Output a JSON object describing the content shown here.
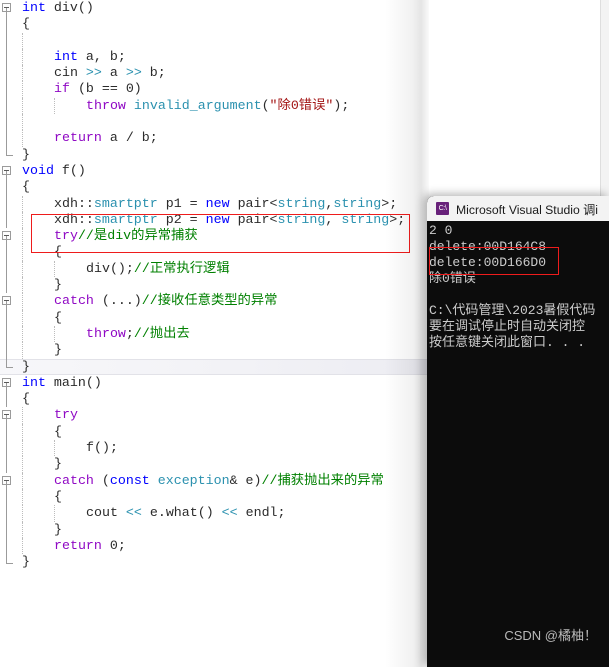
{
  "editor": {
    "language": "cpp",
    "lines": [
      {
        "fold": "open",
        "indent": 0,
        "tokens": [
          {
            "t": "int",
            "c": "kw"
          },
          {
            "t": " div()",
            "c": "plain"
          }
        ]
      },
      {
        "fold": "bar",
        "indent": 0,
        "tokens": [
          {
            "t": "{",
            "c": "plain"
          }
        ]
      },
      {
        "fold": "bar",
        "indent": 1,
        "tokens": []
      },
      {
        "fold": "bar",
        "indent": 1,
        "tokens": [
          {
            "t": "int",
            "c": "kw"
          },
          {
            "t": " a, b;",
            "c": "plain"
          }
        ]
      },
      {
        "fold": "bar",
        "indent": 1,
        "tokens": [
          {
            "t": "cin ",
            "c": "plain"
          },
          {
            "t": ">>",
            "c": "type"
          },
          {
            "t": " a ",
            "c": "plain"
          },
          {
            "t": ">>",
            "c": "type"
          },
          {
            "t": " b;",
            "c": "plain"
          }
        ]
      },
      {
        "fold": "bar",
        "indent": 1,
        "tokens": [
          {
            "t": "if",
            "c": "kw2"
          },
          {
            "t": " (b == 0)",
            "c": "plain"
          }
        ]
      },
      {
        "fold": "bar",
        "indent": 2,
        "tokens": [
          {
            "t": "throw",
            "c": "kw2"
          },
          {
            "t": " ",
            "c": "plain"
          },
          {
            "t": "invalid_argument",
            "c": "type"
          },
          {
            "t": "(",
            "c": "plain"
          },
          {
            "t": "\"除0错误\"",
            "c": "str"
          },
          {
            "t": ");",
            "c": "plain"
          }
        ]
      },
      {
        "fold": "bar",
        "indent": 1,
        "tokens": []
      },
      {
        "fold": "bar",
        "indent": 1,
        "tokens": [
          {
            "t": "return",
            "c": "kw2"
          },
          {
            "t": " a / b;",
            "c": "plain"
          }
        ]
      },
      {
        "fold": "end",
        "indent": 0,
        "tokens": [
          {
            "t": "}",
            "c": "plain"
          }
        ]
      },
      {
        "fold": "open",
        "indent": 0,
        "tokens": [
          {
            "t": "void",
            "c": "kw"
          },
          {
            "t": " f()",
            "c": "plain"
          }
        ]
      },
      {
        "fold": "bar",
        "indent": 0,
        "tokens": [
          {
            "t": "{",
            "c": "plain"
          }
        ]
      },
      {
        "fold": "bar",
        "indent": 1,
        "tokens": [
          {
            "t": "xdh::",
            "c": "plain"
          },
          {
            "t": "smartptr",
            "c": "type"
          },
          {
            "t": " p1 = ",
            "c": "plain"
          },
          {
            "t": "new",
            "c": "kw"
          },
          {
            "t": " pair<",
            "c": "plain"
          },
          {
            "t": "string",
            "c": "type"
          },
          {
            "t": ",",
            "c": "plain"
          },
          {
            "t": "string",
            "c": "type"
          },
          {
            "t": ">;",
            "c": "plain"
          }
        ]
      },
      {
        "fold": "bar",
        "indent": 1,
        "tokens": [
          {
            "t": "xdh::",
            "c": "plain"
          },
          {
            "t": "smartptr",
            "c": "type"
          },
          {
            "t": " p2 = ",
            "c": "plain"
          },
          {
            "t": "new",
            "c": "kw"
          },
          {
            "t": " pair<",
            "c": "plain"
          },
          {
            "t": "string",
            "c": "type"
          },
          {
            "t": ", ",
            "c": "plain"
          },
          {
            "t": "string",
            "c": "type"
          },
          {
            "t": ">;",
            "c": "plain"
          }
        ]
      },
      {
        "fold": "open2",
        "indent": 1,
        "tokens": [
          {
            "t": "try",
            "c": "kw2"
          },
          {
            "t": "//是div的异常捕获",
            "c": "cmt"
          }
        ]
      },
      {
        "fold": "bar",
        "indent": 1,
        "tokens": [
          {
            "t": "{",
            "c": "plain"
          }
        ]
      },
      {
        "fold": "bar",
        "indent": 2,
        "tokens": [
          {
            "t": "div();",
            "c": "plain"
          },
          {
            "t": "//正常执行逻辑",
            "c": "cmt"
          }
        ]
      },
      {
        "fold": "bar",
        "indent": 1,
        "tokens": [
          {
            "t": "}",
            "c": "plain"
          }
        ]
      },
      {
        "fold": "open2",
        "indent": 1,
        "tokens": [
          {
            "t": "catch",
            "c": "kw2"
          },
          {
            "t": " (...)",
            "c": "plain"
          },
          {
            "t": "//接收任意类型的异常",
            "c": "cmt"
          }
        ]
      },
      {
        "fold": "bar",
        "indent": 1,
        "tokens": [
          {
            "t": "{",
            "c": "plain"
          }
        ]
      },
      {
        "fold": "bar",
        "indent": 2,
        "tokens": [
          {
            "t": "throw",
            "c": "kw2"
          },
          {
            "t": ";",
            "c": "plain"
          },
          {
            "t": "//抛出去",
            "c": "cmt"
          }
        ]
      },
      {
        "fold": "bar",
        "indent": 1,
        "tokens": [
          {
            "t": "}",
            "c": "plain"
          }
        ]
      },
      {
        "fold": "end",
        "indent": 0,
        "current": true,
        "tokens": [
          {
            "t": "}",
            "c": "plain"
          }
        ]
      },
      {
        "fold": "open",
        "indent": 0,
        "tokens": [
          {
            "t": "int",
            "c": "kw"
          },
          {
            "t": " main()",
            "c": "plain"
          }
        ]
      },
      {
        "fold": "bar",
        "indent": 0,
        "tokens": [
          {
            "t": "{",
            "c": "plain"
          }
        ]
      },
      {
        "fold": "open2",
        "indent": 1,
        "tokens": [
          {
            "t": "try",
            "c": "kw2"
          }
        ]
      },
      {
        "fold": "bar",
        "indent": 1,
        "tokens": [
          {
            "t": "{",
            "c": "plain"
          }
        ]
      },
      {
        "fold": "bar",
        "indent": 2,
        "tokens": [
          {
            "t": "f();",
            "c": "plain"
          }
        ]
      },
      {
        "fold": "bar",
        "indent": 1,
        "tokens": [
          {
            "t": "}",
            "c": "plain"
          }
        ]
      },
      {
        "fold": "open2",
        "indent": 1,
        "tokens": [
          {
            "t": "catch",
            "c": "kw2"
          },
          {
            "t": " (",
            "c": "plain"
          },
          {
            "t": "const",
            "c": "kw"
          },
          {
            "t": " ",
            "c": "plain"
          },
          {
            "t": "exception",
            "c": "type"
          },
          {
            "t": "& e)",
            "c": "plain"
          },
          {
            "t": "//捕获抛出来的异常",
            "c": "cmt"
          }
        ]
      },
      {
        "fold": "bar",
        "indent": 1,
        "tokens": [
          {
            "t": "{",
            "c": "plain"
          }
        ]
      },
      {
        "fold": "bar",
        "indent": 2,
        "tokens": [
          {
            "t": "cout ",
            "c": "plain"
          },
          {
            "t": "<<",
            "c": "type"
          },
          {
            "t": " e.what() ",
            "c": "plain"
          },
          {
            "t": "<<",
            "c": "type"
          },
          {
            "t": " endl;",
            "c": "plain"
          }
        ]
      },
      {
        "fold": "bar",
        "indent": 1,
        "tokens": [
          {
            "t": "}",
            "c": "plain"
          }
        ]
      },
      {
        "fold": "bar",
        "indent": 1,
        "tokens": [
          {
            "t": "return",
            "c": "kw2"
          },
          {
            "t": " 0;",
            "c": "plain"
          }
        ]
      },
      {
        "fold": "end",
        "indent": 0,
        "tokens": [
          {
            "t": "}",
            "c": "plain"
          }
        ]
      }
    ],
    "annotation_box_color": "#ee1c1c"
  },
  "console": {
    "title": "Microsoft Visual Studio 调i",
    "icon": "vs-console-icon",
    "icon_glyph": "C:\\",
    "lines": [
      "2 0",
      "delete:00D164C8",
      "delete:00D166D0",
      "除0错误",
      "",
      "C:\\代码管理\\2023暑假代码",
      "要在调试停止时自动关闭控",
      "按任意键关闭此窗口. . ."
    ],
    "annotation_box_color": "#ee1c1c",
    "background": "#0c0c0c",
    "text_color": "#cccccc"
  },
  "watermark": {
    "text": "CSDN @橘柚！"
  }
}
